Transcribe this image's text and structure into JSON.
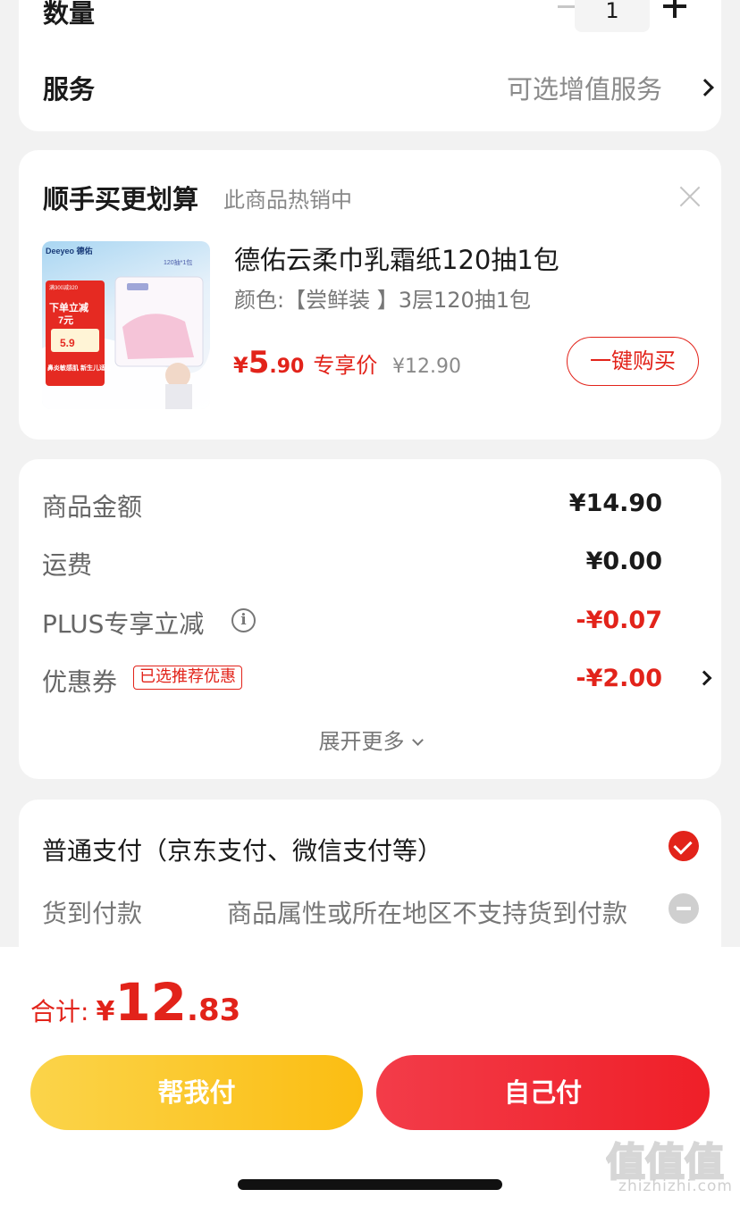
{
  "order": {
    "qty_label": "数量",
    "qty_value": "1",
    "service_label": "服务",
    "service_value": "可选增值服务"
  },
  "addon": {
    "title": "顺手买更划算",
    "subtitle": "此商品热销中",
    "product": {
      "title": "德佑云柔巾乳霜纸120抽1包",
      "spec": "颜色:【尝鲜装 】3层120抽1包",
      "price_yen": "¥",
      "price_int": "5",
      "price_dec": ".90",
      "price_tag": "专享价",
      "original_price": "¥12.90",
      "buy_label": "一键购买",
      "image_text": {
        "brand": "Deeyeo 德佑",
        "pack": "120抽*1包",
        "promo_top": "满300减320",
        "promo_main": "下单立减",
        "promo_amount": "7元",
        "promo_price": "5.9",
        "promo_bottom": "鼻炎敏感肌 新生儿适用"
      }
    }
  },
  "summary": {
    "rows": [
      {
        "label": "商品金额",
        "value": "¥14.90"
      },
      {
        "label": "运费",
        "value": "¥0.00"
      },
      {
        "label": "PLUS专享立减",
        "value": "-¥0.07"
      },
      {
        "label": "优惠券",
        "value": "-¥2.00"
      }
    ],
    "coupon_badge": "已选推荐优惠",
    "expand_label": "展开更多"
  },
  "payment": {
    "normal_label": "普通支付（京东支付、微信支付等）",
    "cod_label": "货到付款",
    "cod_note": "商品属性或所在地区不支持货到付款"
  },
  "footer": {
    "total_label": "合计:",
    "total_yen": "¥",
    "total_int": "12",
    "total_dec": ".83",
    "help_pay_label": "帮我付",
    "self_pay_label": "自己付"
  },
  "watermark": {
    "logo": "值值值",
    "site": "zhizhizhi.com"
  },
  "colors": {
    "accent_red": "#e2231a",
    "help_yellow": "#fbbd12",
    "self_red": "#ef1f28"
  }
}
